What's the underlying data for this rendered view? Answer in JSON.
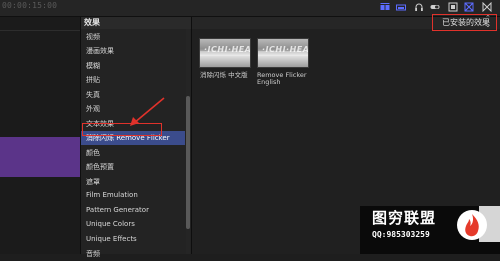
{
  "timeline": {
    "timecode": "00:00:15:00"
  },
  "effects_panel": {
    "title": "效果",
    "categories": [
      {
        "label": "视频",
        "selected": false
      },
      {
        "label": "漫画效果",
        "selected": false
      },
      {
        "label": "模糊",
        "selected": false
      },
      {
        "label": "拼贴",
        "selected": false
      },
      {
        "label": "失真",
        "selected": false
      },
      {
        "label": "外观",
        "selected": false
      },
      {
        "label": "文本效果",
        "selected": false
      },
      {
        "label": "消除闪烁 Remove Flicker",
        "selected": true
      },
      {
        "label": "颜色",
        "selected": false
      },
      {
        "label": "颜色预置",
        "selected": false
      },
      {
        "label": "遮罩",
        "selected": false
      },
      {
        "label": "Film Emulation",
        "selected": false
      },
      {
        "label": "Pattern Generator",
        "selected": false
      },
      {
        "label": "Unique Colors",
        "selected": false
      },
      {
        "label": "Unique Effects",
        "selected": false
      },
      {
        "label": "音频",
        "selected": false
      }
    ]
  },
  "browser": {
    "filter_dropdown": "已安装的效果",
    "items": [
      {
        "label_line1": "消除闪烁 中文版",
        "label_line2": ""
      },
      {
        "label_line1": "Remove Flicker",
        "label_line2": "English"
      }
    ]
  },
  "watermark": {
    "title": "图穷联盟",
    "qq": "QQ:985303259"
  },
  "colors": {
    "selection": "#3b4c8c",
    "annotation_red": "#e0322b",
    "clip_purple": "#5b3489",
    "accent_blue": "#5c6cff"
  }
}
